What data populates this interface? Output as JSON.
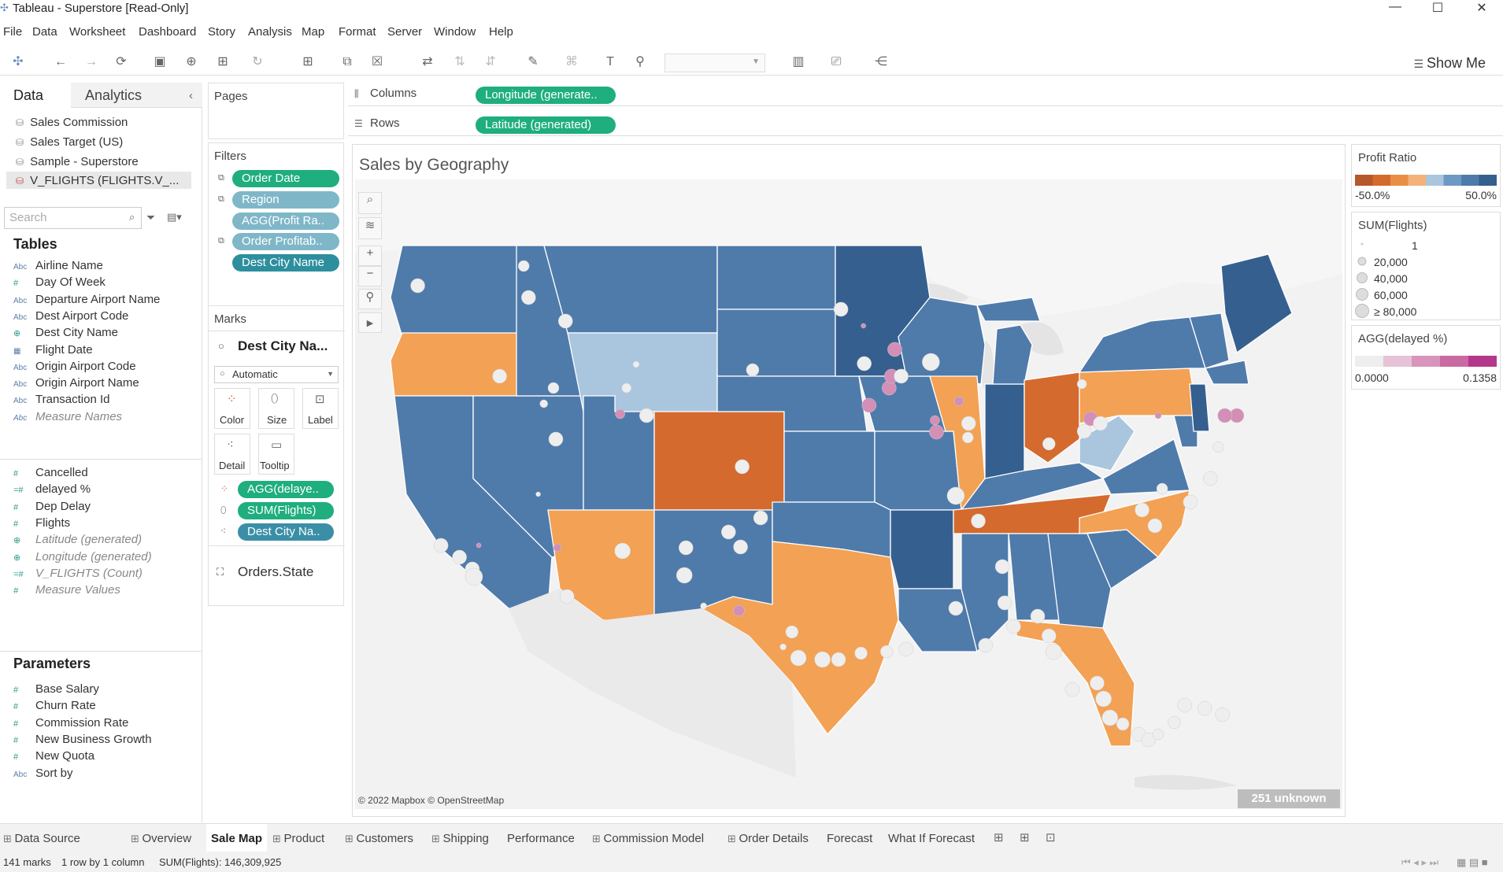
{
  "window": {
    "title": "Tableau - Superstore [Read-Only]"
  },
  "menu": [
    "File",
    "Data",
    "Worksheet",
    "Dashboard",
    "Story",
    "Analysis",
    "Map",
    "Format",
    "Server",
    "Window",
    "Help"
  ],
  "toolbar": {
    "show_me": "Show Me"
  },
  "left_panel": {
    "tabs": [
      "Data",
      "Analytics"
    ],
    "data_sources": [
      "Sales Commission",
      "Sales Target (US)",
      "Sample - Superstore",
      "V_FLIGHTS (FLIGHTS.V_..."
    ],
    "search_placeholder": "Search",
    "tables_header": "Tables",
    "dimensions": [
      {
        "name": "Airline Name",
        "type": "Abc"
      },
      {
        "name": "Day Of Week",
        "type": "#"
      },
      {
        "name": "Departure Airport Name",
        "type": "Abc"
      },
      {
        "name": "Dest Airport Code",
        "type": "Abc"
      },
      {
        "name": "Dest City Name",
        "type": "geo"
      },
      {
        "name": "Flight Date",
        "type": "date"
      },
      {
        "name": "Origin Airport Code",
        "type": "Abc"
      },
      {
        "name": "Origin Airport Name",
        "type": "Abc"
      },
      {
        "name": "Transaction Id",
        "type": "Abc"
      },
      {
        "name": "Measure Names",
        "type": "Abc",
        "italic": true
      }
    ],
    "measures": [
      {
        "name": "Cancelled",
        "type": "#"
      },
      {
        "name": "delayed %",
        "type": "=#"
      },
      {
        "name": "Dep Delay",
        "type": "#"
      },
      {
        "name": "Flights",
        "type": "#"
      },
      {
        "name": "Latitude (generated)",
        "type": "geo",
        "italic": true
      },
      {
        "name": "Longitude (generated)",
        "type": "geo",
        "italic": true
      },
      {
        "name": "V_FLIGHTS (Count)",
        "type": "=#",
        "italic": true
      },
      {
        "name": "Measure Values",
        "type": "#",
        "italic": true
      }
    ],
    "parameters_header": "Parameters",
    "parameters": [
      {
        "name": "Base Salary",
        "type": "#"
      },
      {
        "name": "Churn Rate",
        "type": "#"
      },
      {
        "name": "Commission Rate",
        "type": "#"
      },
      {
        "name": "New Business Growth",
        "type": "#"
      },
      {
        "name": "New Quota",
        "type": "#"
      },
      {
        "name": "Sort by",
        "type": "Abc"
      }
    ]
  },
  "pages": {
    "header": "Pages"
  },
  "filters": {
    "header": "Filters",
    "items": [
      "Order Date",
      "Region",
      "AGG(Profit Ra..",
      "Order Profitab..",
      "Dest City Name"
    ]
  },
  "marks": {
    "header": "Marks",
    "layer": "Dest City Na...",
    "mark_type": "Automatic",
    "buttons": [
      "Color",
      "Size",
      "Label",
      "Detail",
      "Tooltip"
    ],
    "pills": [
      "AGG(delaye..",
      "SUM(Flights)",
      "Dest City Na.."
    ],
    "layer2": "Orders.State"
  },
  "shelves": {
    "columns_label": "Columns",
    "columns_pill": "Longitude (generate..",
    "rows_label": "Rows",
    "rows_pill": "Latitude (generated)"
  },
  "viz": {
    "title": "Sales by Geography",
    "attribution": "© 2022 Mapbox © OpenStreetMap",
    "unknown": "251 unknown"
  },
  "legends": {
    "profit_ratio": {
      "title": "Profit Ratio",
      "min": "-50.0%",
      "max": "50.0%",
      "colors": [
        "#b5582a",
        "#d46a2e",
        "#e98f45",
        "#f3b27a",
        "#a9c6de",
        "#6d99c4",
        "#4f7bab",
        "#355f8f"
      ]
    },
    "flights": {
      "title": "SUM(Flights)",
      "values": [
        "1",
        "20,000",
        "40,000",
        "60,000",
        "≥ 80,000"
      ]
    },
    "delayed": {
      "title": "AGG(delayed %)",
      "min": "0.0000",
      "max": "0.1358",
      "colors": [
        "#eeeeee",
        "#e6c3d6",
        "#d894bb",
        "#c96aa3",
        "#b4388a"
      ]
    }
  },
  "bottom_tabs": [
    {
      "label": "Data Source",
      "icon": true
    },
    {
      "label": "Overview",
      "icon": true
    },
    {
      "label": "Sale Map",
      "active": true
    },
    {
      "label": "Product",
      "icon": true
    },
    {
      "label": "Customers",
      "icon": true
    },
    {
      "label": "Shipping",
      "icon": true
    },
    {
      "label": "Performance"
    },
    {
      "label": "Commission Model",
      "icon": true
    },
    {
      "label": "Order Details",
      "icon": true
    },
    {
      "label": "Forecast"
    },
    {
      "label": "What If Forecast"
    }
  ],
  "status": {
    "marks": "141 marks",
    "rows": "1 row by 1 column",
    "sum": "SUM(Flights): 146,309,925"
  }
}
